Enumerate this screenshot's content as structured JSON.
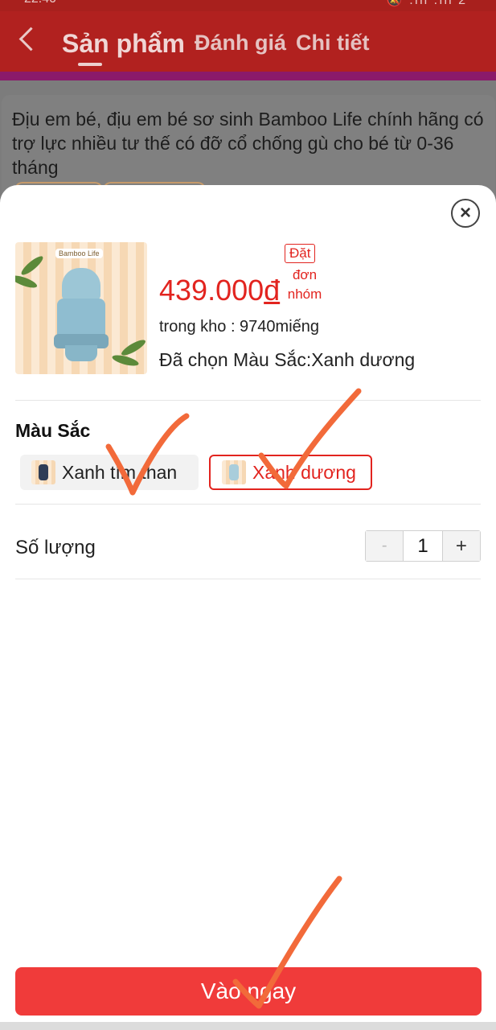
{
  "status_bar": {
    "time": "22:40",
    "right": "🔕 .ıll .ıll 2"
  },
  "header": {
    "tabs": [
      {
        "label": "Sản phẩm",
        "active": true
      },
      {
        "label": "Đánh giá",
        "active": false
      },
      {
        "label": "Chi tiết",
        "active": false
      }
    ]
  },
  "background_product": {
    "title": "Địu em bé, địu em bé sơ sinh Bamboo Life chính hãng có trợ lực nhiều tư thế có đỡ cổ chống gù cho bé từ 0-36 tháng"
  },
  "sheet": {
    "close_icon": "close-icon",
    "image_logo": "Bamboo Life",
    "price": "439.000",
    "currency": "đ",
    "group_tag": "Đặt",
    "group_sub": "đơn nhóm",
    "stock": "trong kho : 9740miếng",
    "selected": "Đã chọn Màu Sắc:Xanh dương",
    "color_section": "Màu Sắc",
    "colors": [
      {
        "label": "Xanh tím than",
        "selected": false,
        "swatch": "#2f3d56"
      },
      {
        "label": "Xanh dương",
        "selected": true,
        "swatch": "#a9cddb"
      }
    ],
    "quantity_label": "Số lượng",
    "quantity": {
      "minus": "-",
      "value": "1",
      "plus": "+"
    },
    "buy_button": "Vào ngay"
  },
  "colors": {
    "header": "#b1211f",
    "accent": "#e2241f",
    "button": "#f03b3a",
    "annotation": "#f26a3a"
  }
}
